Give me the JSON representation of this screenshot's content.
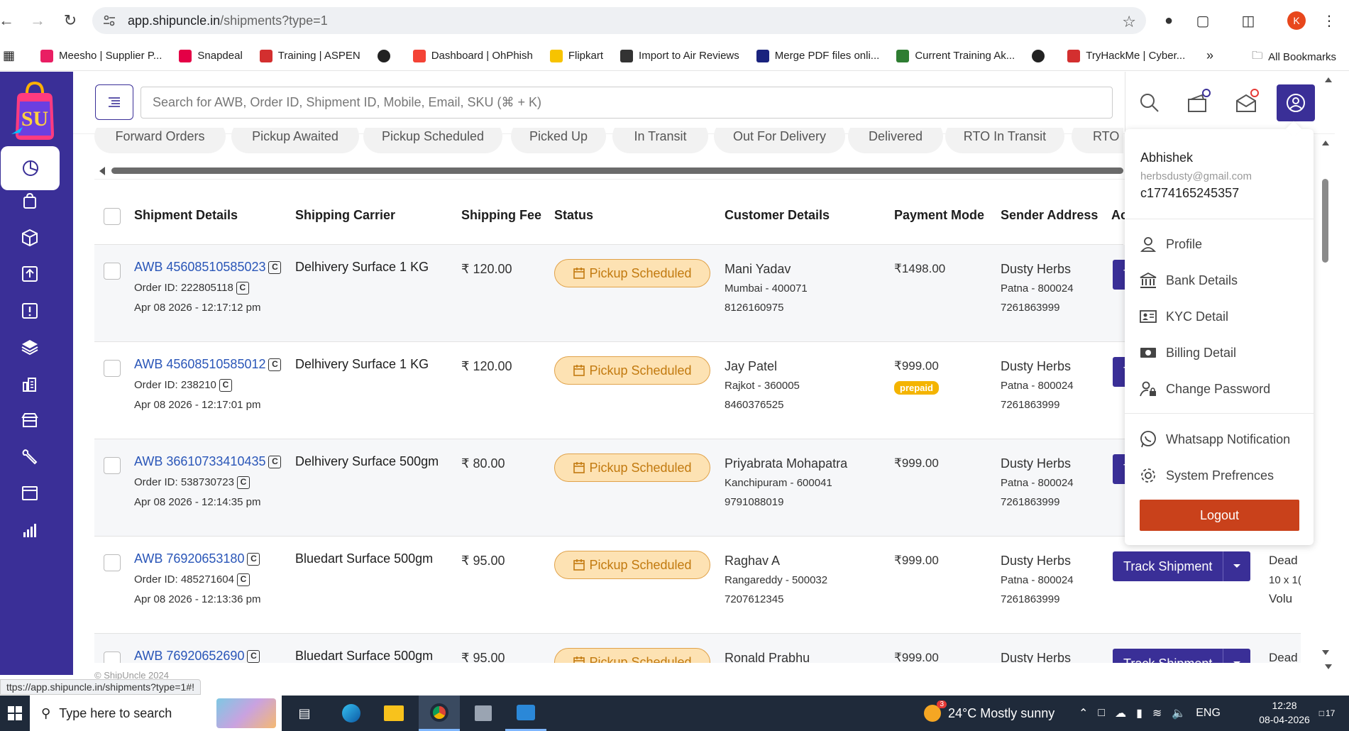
{
  "browser": {
    "url_host": "app.shipuncle.in",
    "url_path": "/shipments?type=1",
    "profile_initial": "K",
    "status_url": "ttps://app.shipuncle.in/shipments?type=1#!",
    "all_bookmarks": "All Bookmarks",
    "bookmarks": [
      {
        "label": "Meesho | Supplier P...",
        "color": "#e91e63"
      },
      {
        "label": "Snapdeal",
        "color": "#e40046"
      },
      {
        "label": "Training | ASPEN",
        "color": "#d32f2f"
      },
      {
        "label": "",
        "color": "#222222"
      },
      {
        "label": "Dashboard | OhPhish",
        "color": "#f44336"
      },
      {
        "label": "Flipkart",
        "color": "#f7c300"
      },
      {
        "label": "Import to Air Reviews",
        "color": "#333333"
      },
      {
        "label": "Merge PDF files onli...",
        "color": "#1a237e"
      },
      {
        "label": "Current Training Ak...",
        "color": "#2e7d32"
      },
      {
        "label": "",
        "color": "#222222"
      },
      {
        "label": "TryHackMe | Cyber...",
        "color": "#d32f2f"
      }
    ]
  },
  "header": {
    "search_placeholder": "Search for AWB, Order ID, Shipment ID, Mobile, Email, SKU (⌘ + K)"
  },
  "tabs": [
    "Forward Orders",
    "Pickup Awaited",
    "Pickup Scheduled",
    "Picked Up",
    "In Transit",
    "Out For Delivery",
    "Delivered",
    "RTO In Transit",
    "RTO D"
  ],
  "table": {
    "columns": [
      "Shipment Details",
      "Shipping Carrier",
      "Shipping Fee",
      "Status",
      "Customer Details",
      "Payment Mode",
      "Sender Address",
      "Ac"
    ],
    "track_label": "Track Shipment",
    "rows": [
      {
        "awb": "AWB 45608510585023",
        "order_id": "Order ID: 222805118",
        "date": "Apr 08 2026 - 12:17:12 pm",
        "carrier": "Delhivery Surface 1 KG",
        "fee": "₹ 120.00",
        "status": "Pickup Scheduled",
        "customer": "Mani Yadav",
        "city": "Mumbai - 400071",
        "phone": "8126160975",
        "amount": "₹1498.00",
        "badge": "",
        "sender": "Dusty Herbs",
        "sender_city": "Patna - 800024",
        "sender_phone": "7261863999",
        "weight_title": "",
        "weight_dim": "",
        "weight_vol": ""
      },
      {
        "awb": "AWB 45608510585012",
        "order_id": "Order ID: 238210",
        "date": "Apr 08 2026 - 12:17:01 pm",
        "carrier": "Delhivery Surface 1 KG",
        "fee": "₹ 120.00",
        "status": "Pickup Scheduled",
        "customer": "Jay Patel",
        "city": "Rajkot - 360005",
        "phone": "8460376525",
        "amount": "₹999.00",
        "badge": "prepaid",
        "sender": "Dusty Herbs",
        "sender_city": "Patna - 800024",
        "sender_phone": "7261863999",
        "weight_title": "",
        "weight_dim": "",
        "weight_vol": ""
      },
      {
        "awb": "AWB 36610733410435",
        "order_id": "Order ID: 538730723",
        "date": "Apr 08 2026 - 12:14:35 pm",
        "carrier": "Delhivery Surface 500gm",
        "fee": "₹ 80.00",
        "status": "Pickup Scheduled",
        "customer": "Priyabrata Mohapatra",
        "city": "Kanchipuram - 600041",
        "phone": "9791088019",
        "amount": "₹999.00",
        "badge": "",
        "sender": "Dusty Herbs",
        "sender_city": "Patna - 800024",
        "sender_phone": "7261863999",
        "weight_title": "",
        "weight_dim": "",
        "weight_vol": ""
      },
      {
        "awb": "AWB 76920653180",
        "order_id": "Order ID: 485271604",
        "date": "Apr 08 2026 - 12:13:36 pm",
        "carrier": "Bluedart Surface 500gm",
        "fee": "₹ 95.00",
        "status": "Pickup Scheduled",
        "customer": "Raghav A",
        "city": "Rangareddy - 500032",
        "phone": "7207612345",
        "amount": "₹999.00",
        "badge": "",
        "sender": "Dusty Herbs",
        "sender_city": "Patna - 800024",
        "sender_phone": "7261863999",
        "weight_title": "Dead",
        "weight_dim": "10 x 1(",
        "weight_vol": "Volu"
      },
      {
        "awb": "AWB 76920652690",
        "order_id": "",
        "date": "",
        "carrier": "Bluedart Surface 500gm",
        "fee": "₹ 95.00",
        "status": "Pickup Scheduled",
        "customer": "Ronald Prabhu",
        "city": "",
        "phone": "",
        "amount": "₹999.00",
        "badge": "",
        "sender": "Dusty Herbs",
        "sender_city": "",
        "sender_phone": "",
        "weight_title": "Dead",
        "weight_dim": "",
        "weight_vol": ""
      }
    ]
  },
  "profile_menu": {
    "name": "Abhishek",
    "email": "herbsdusty@gmail.com",
    "code": "c1774165245357",
    "items": [
      "Profile",
      "Bank Details",
      "KYC Detail",
      "Billing Detail",
      "Change Password"
    ],
    "items2": [
      "Whatsapp Notification",
      "System Prefrences"
    ],
    "logout": "Logout"
  },
  "footer": {
    "copyright": "© ShipUncle 2024"
  },
  "taskbar": {
    "search_placeholder": "Type here to search",
    "weather": "24°C  Mostly sunny",
    "weather_badge": "3",
    "lang": "ENG",
    "time": "12:28",
    "date": "08-04-2026",
    "notif_count": "17"
  },
  "colors": {
    "brand": "#3a2f97",
    "status_bg": "#fde2b3",
    "status_text": "#c27a0f",
    "logout": "#c9411b",
    "prepaid": "#f4b400"
  }
}
